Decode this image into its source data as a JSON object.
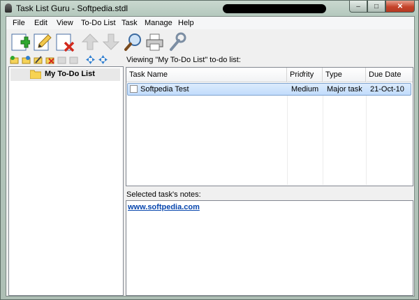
{
  "window": {
    "title": "Task List Guru - Softpedia.stdl"
  },
  "menu": [
    "File",
    "Edit",
    "View",
    "To-Do List",
    "Task",
    "Manage",
    "Help"
  ],
  "toolbar": {
    "buttons": [
      "add-task",
      "edit-task",
      "delete-task",
      "move-up",
      "move-down",
      "search",
      "print",
      "settings"
    ]
  },
  "tree": {
    "root_label": "My To-Do List"
  },
  "list": {
    "viewing_label": "Viewing \"My To-Do List\" to-do list:",
    "columns": [
      "Task Name",
      "Priority",
      "Type",
      "Due Date"
    ],
    "rows": [
      {
        "name": "Softpedia Test",
        "priority": "Medium",
        "type": "Major task",
        "due": "21-Oct-10",
        "checked": false
      }
    ]
  },
  "notes": {
    "label": "Selected task's notes:",
    "content": "www.softpedia.com"
  },
  "colors": {
    "selection": "#c1dcfc",
    "link": "#0645ad",
    "close": "#c5432a"
  }
}
